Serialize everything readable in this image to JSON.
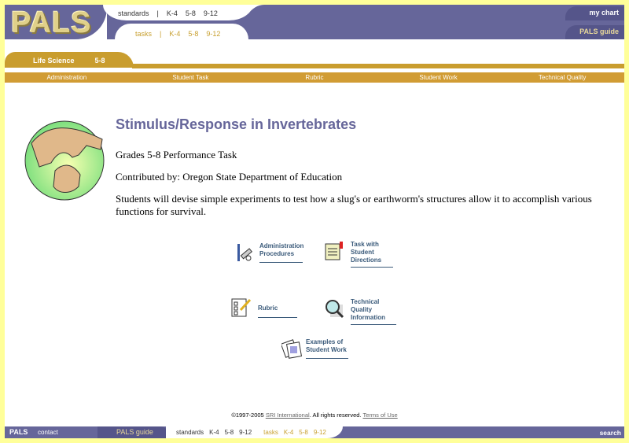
{
  "header": {
    "logo": "PALS",
    "standards": {
      "label": "standards",
      "sep": "|",
      "grades": [
        "K-4",
        "5-8",
        "9-12"
      ]
    },
    "tasks": {
      "label": "tasks",
      "sep": "|",
      "grades": [
        "K-4",
        "5-8",
        "9-12"
      ]
    },
    "my_chart": "my chart",
    "pals_guide": "PALS guide"
  },
  "tab": {
    "subject": "Life Science",
    "grade": "5-8"
  },
  "subnav": [
    "Administration",
    "Student Task",
    "Rubric",
    "Student Work",
    "Technical Quality"
  ],
  "main": {
    "title": "Stimulus/Response in Invertebrates",
    "grades": "Grades 5-8 Performance Task",
    "contributor": "Contributed by: Oregon State Department of Education",
    "description": "Students will devise simple experiments to test how a slug's or earthworm's structures allow it to accomplish various functions for survival."
  },
  "links": [
    {
      "line1": "Administration",
      "line2": "Procedures"
    },
    {
      "line1": "Task with",
      "line2": "Student Directions"
    },
    {
      "line1": "Rubric",
      "line2": ""
    },
    {
      "line1": "Technical Quality",
      "line2": "Information"
    },
    {
      "line1": "Examples of",
      "line2": "Student Work"
    }
  ],
  "footer": {
    "copyright": "©1997-2005",
    "sri": "SRI International",
    "rights": ". All rights reserved.",
    "terms": "Terms of Use",
    "pals": "PALS",
    "contact": "contact",
    "pals_guide": "PALS guide",
    "standards": "standards",
    "std_grades": [
      "K-4",
      "5-8",
      "9-12"
    ],
    "tasks": "tasks",
    "task_grades": [
      "K-4",
      "5-8",
      "9-12"
    ],
    "search": "search"
  },
  "colors": {
    "purple": "#66669a",
    "gold": "#c99d2e",
    "border": "#ffff99"
  }
}
